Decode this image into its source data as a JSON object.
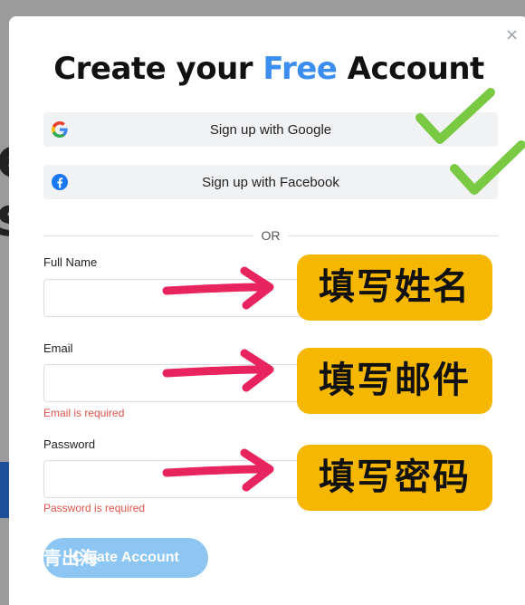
{
  "dialog": {
    "title_pre": "Create your ",
    "title_highlight": "Free",
    "title_post": " Account",
    "close_symbol": "×"
  },
  "social": {
    "google_label": "Sign up with Google",
    "facebook_label": "Sign up with Facebook"
  },
  "divider": "OR",
  "fields": {
    "full_name": {
      "label": "Full Name",
      "value": ""
    },
    "email": {
      "label": "Email",
      "value": "",
      "error": "Email is required"
    },
    "password": {
      "label": "Password",
      "value": "",
      "error": "Password is required"
    }
  },
  "annotations": {
    "name_hint": "填写姓名",
    "email_hint": "填写邮件",
    "password_hint": "填写密码"
  },
  "submit_label": "Create Account",
  "watermark": "青出海",
  "colors": {
    "accent": "#3b8ef0",
    "error": "#e0554a",
    "annotation_badge": "#f5b700",
    "arrow": "#e8245f",
    "check": "#7ac943",
    "submit_disabled": "#8ec6f3"
  }
}
